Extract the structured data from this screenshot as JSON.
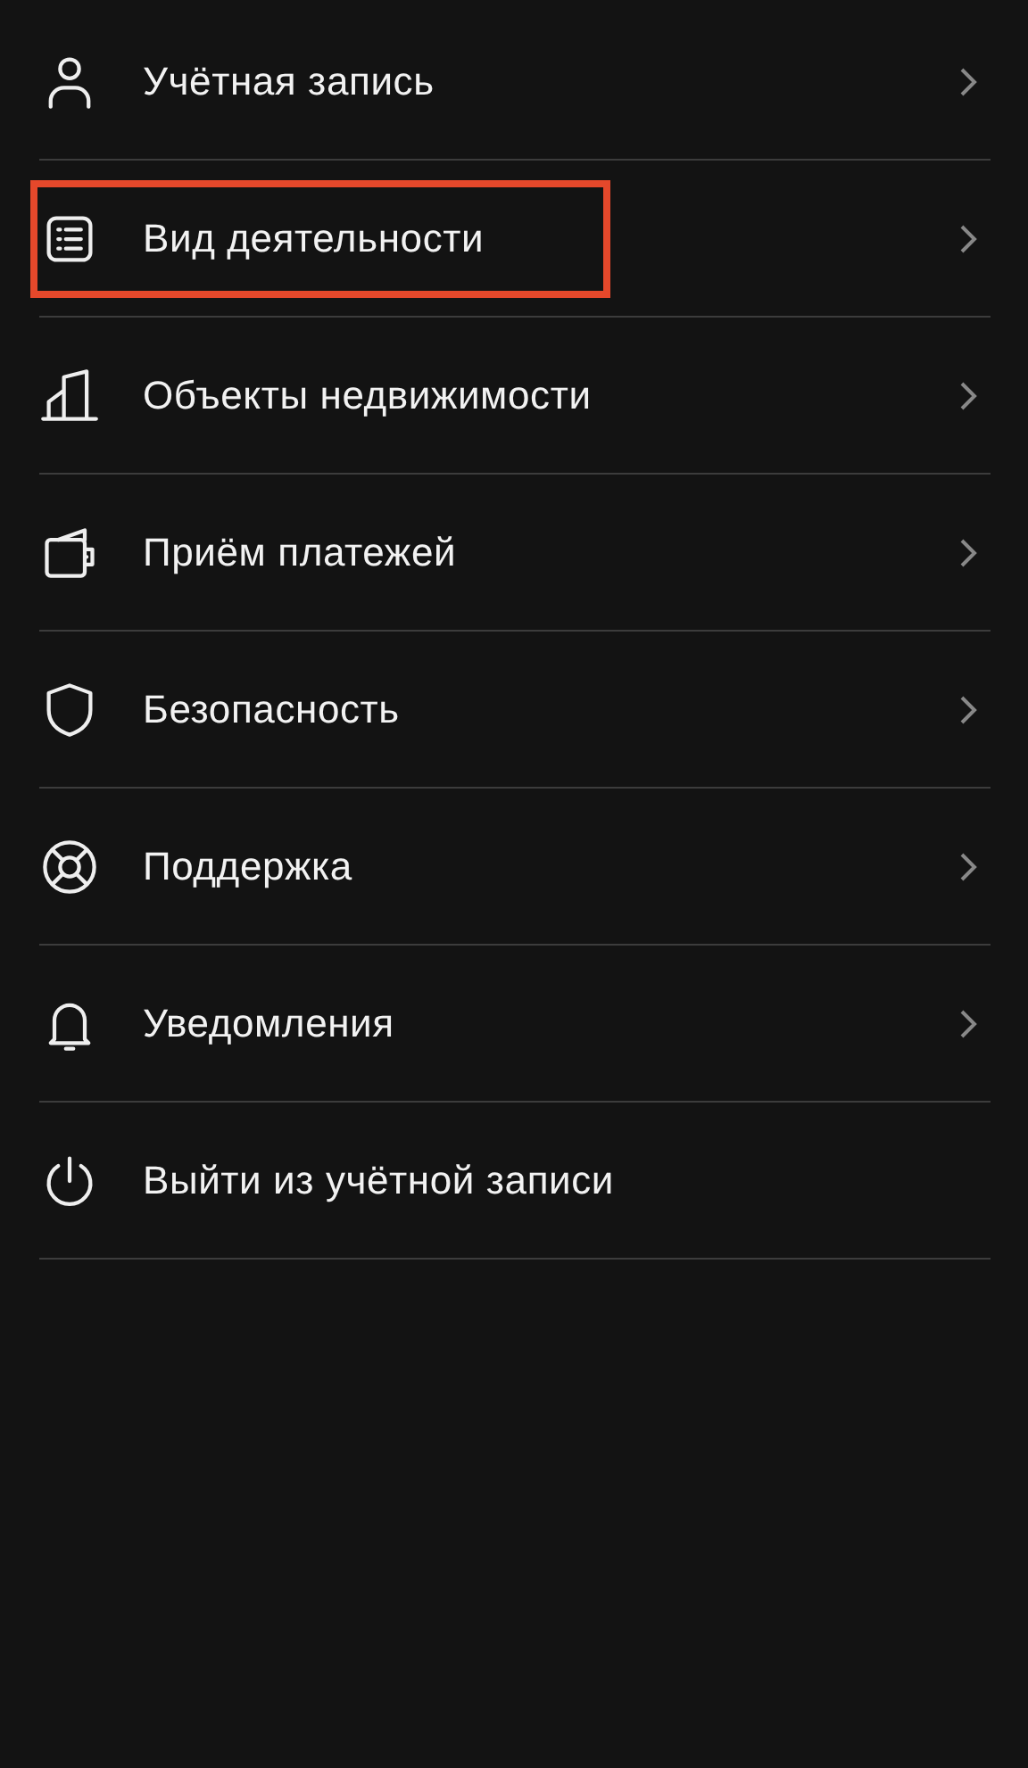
{
  "menu": {
    "items": [
      {
        "label": "Учётная запись",
        "chevron": true,
        "highlighted": false
      },
      {
        "label": "Вид деятельности",
        "chevron": true,
        "highlighted": true
      },
      {
        "label": "Объекты недвижимости",
        "chevron": true,
        "highlighted": false
      },
      {
        "label": "Приём платежей",
        "chevron": true,
        "highlighted": false
      },
      {
        "label": "Безопасность",
        "chevron": true,
        "highlighted": false
      },
      {
        "label": "Поддержка",
        "chevron": true,
        "highlighted": false
      },
      {
        "label": "Уведомления",
        "chevron": true,
        "highlighted": false
      },
      {
        "label": "Выйти из учётной записи",
        "chevron": false,
        "highlighted": false
      }
    ]
  }
}
